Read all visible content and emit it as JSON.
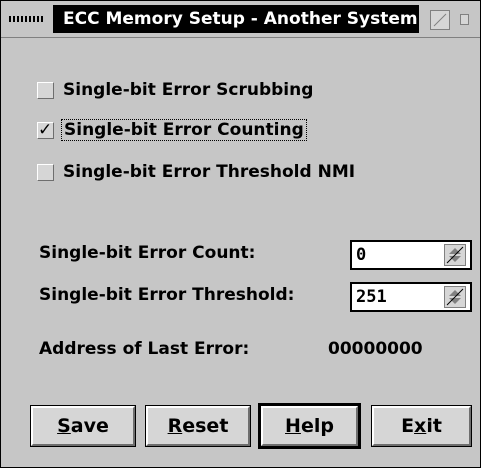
{
  "window": {
    "title": "ECC Memory Setup - Another System"
  },
  "options": [
    {
      "label": "Single-bit Error Scrubbing",
      "checked": false
    },
    {
      "label": "Single-bit Error Counting",
      "checked": true
    },
    {
      "label": "Single-bit Error Threshold NMI",
      "checked": false
    }
  ],
  "fields": {
    "count_label": "Single-bit Error Count:",
    "count_value": "0",
    "threshold_label": "Single-bit Error Threshold:",
    "threshold_value": "251",
    "address_label": "Address of Last Error:",
    "address_value": "00000000"
  },
  "buttons": {
    "save": {
      "mnemonic": "S",
      "rest": "ave"
    },
    "reset": {
      "mnemonic": "R",
      "rest": "eset"
    },
    "help": {
      "mnemonic": "H",
      "rest": "elp"
    },
    "exit": {
      "pre": "E",
      "mnemonic": "x",
      "rest": "it"
    }
  },
  "icons": {
    "system_menu": "system-menu-icon",
    "maximize": "maximize-icon",
    "restore": "restore-icon",
    "checkmark": "checkmark-icon",
    "spin_arrows": "spin-arrows-icon"
  }
}
